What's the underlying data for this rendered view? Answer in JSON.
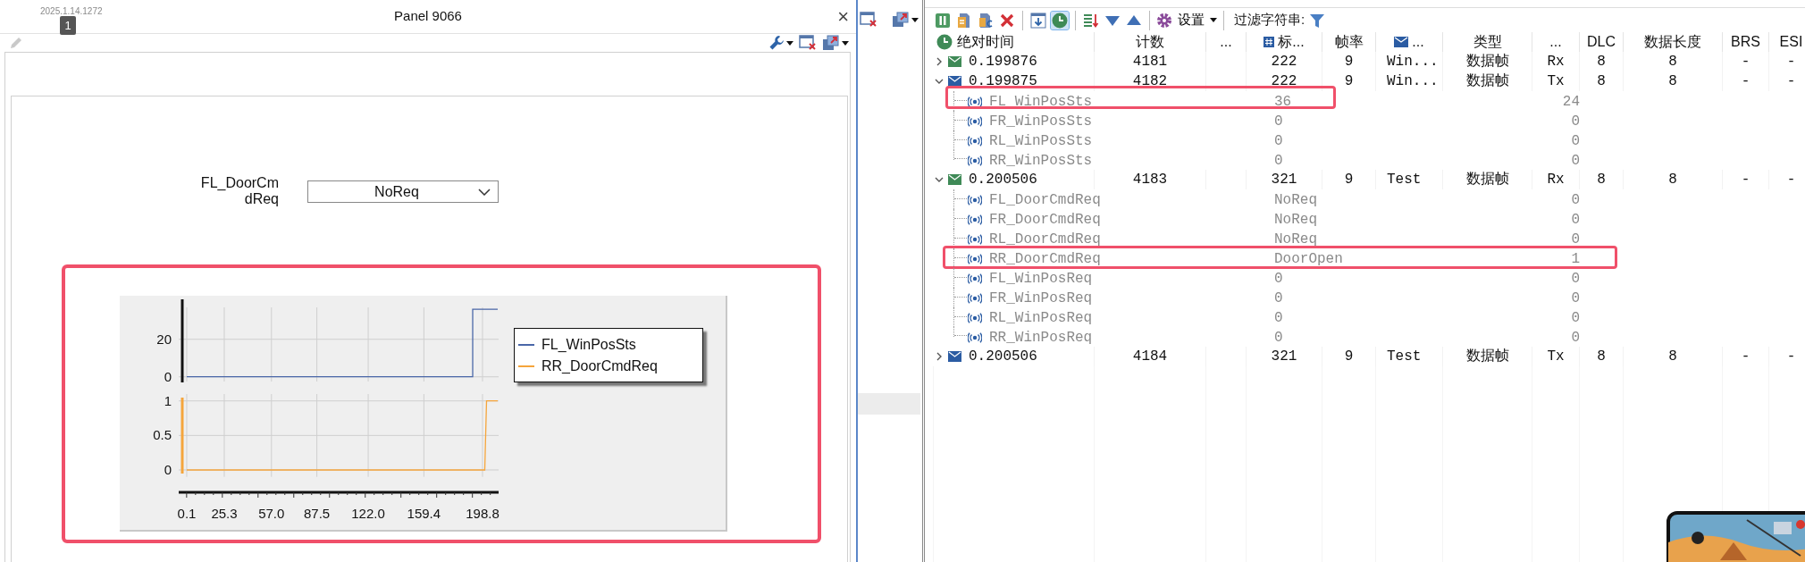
{
  "overlay": {
    "version": "2025.1.14.1272",
    "badge": "1"
  },
  "panel": {
    "title": "Panel 9066",
    "close": "×",
    "toolbar": [
      {
        "kind": "pencil",
        "disabled": true
      },
      {
        "kind": "spacer"
      },
      {
        "kind": "wrench",
        "dropdown": true
      },
      {
        "kind": "close-window"
      },
      {
        "kind": "export",
        "dropdown": true
      }
    ],
    "field": {
      "label": "FL_DoorCmdReq",
      "value": "NoReq"
    },
    "plot": {
      "highlighted": true,
      "upper": {
        "chart_data": {
          "type": "line",
          "grid": true,
          "x": [
            0.1,
            192.2,
            192.2,
            209
          ],
          "xlim": [
            -1.7,
            209
          ],
          "ylim": [
            -2.5,
            37
          ],
          "yticks": [
            0,
            20
          ],
          "series": [
            {
              "name": "FL_WinPosSts",
              "color": "#4a67a8",
              "values": [
                0,
                0,
                36,
                36
              ]
            }
          ]
        }
      },
      "lower": {
        "chart_data": {
          "type": "line",
          "grid": true,
          "x": [
            0.1,
            200.3,
            201.5,
            209
          ],
          "xlim": [
            -1.7,
            209
          ],
          "ylim": [
            -0.1,
            1.1
          ],
          "yticks": [
            0,
            0.5,
            1
          ],
          "xticks": [
            0.1,
            25.3,
            {
              "value": 57,
              "label": "57.0"
            },
            87.5,
            {
              "value": 122,
              "label": "122.0"
            },
            159.4,
            198.8
          ],
          "series": [
            {
              "name": "RR_DoorCmdReq",
              "color": "#f5a53c",
              "values": [
                0,
                0,
                1,
                1
              ]
            }
          ]
        }
      }
    }
  },
  "side_strip": {
    "toolbar": [
      {
        "kind": "close-window"
      },
      {
        "kind": "export",
        "dropdown": true
      }
    ]
  },
  "trace": {
    "toolbar": [
      {
        "kind": "pause",
        "selected": false
      },
      {
        "kind": "page",
        "selected": false
      },
      {
        "kind": "page-c",
        "selected": false
      },
      {
        "kind": "delete",
        "selected": false
      },
      {
        "kind": "separator"
      },
      {
        "kind": "download",
        "selected": false
      },
      {
        "kind": "clock",
        "selected": true
      },
      {
        "kind": "separator"
      },
      {
        "kind": "sort",
        "selected": false
      },
      {
        "kind": "down",
        "selected": false
      },
      {
        "kind": "up",
        "selected": false
      },
      {
        "kind": "separator"
      },
      {
        "kind": "menu",
        "label": "设置",
        "selected": false
      },
      {
        "kind": "separator"
      },
      {
        "kind": "label",
        "label": "过滤字符串:"
      },
      {
        "kind": "filter",
        "selected": false
      }
    ],
    "columns": [
      {
        "label": "绝对时间"
      },
      {
        "label": "计数"
      },
      {
        "label": "..."
      },
      {
        "label": "标..."
      },
      {
        "label": "帧率"
      },
      {
        "label": "..."
      },
      {
        "label": "类型"
      },
      {
        "label": "..."
      },
      {
        "label": "DLC"
      },
      {
        "label": "数据长度"
      },
      {
        "label": "BRS"
      },
      {
        "label": "ESI"
      }
    ],
    "rows": [
      {
        "expanded": false,
        "color": "#3f8a57",
        "cells": {
          "time": "0.199876",
          "count": "4181",
          "id": "222",
          "frame_rate": "9",
          "column_6": "Win...",
          "type": "数据帧",
          "column_8": "Rx",
          "dlc": "8",
          "data_length": "8",
          "brs": "-",
          "esi": "-"
        }
      },
      {
        "expanded": true,
        "color": "#2b5ca3",
        "cells": {
          "time": "0.199875",
          "count": "4182",
          "id": "222",
          "frame_rate": "9",
          "column_6": "Win...",
          "type": "数据帧",
          "column_8": "Tx",
          "dlc": "8",
          "data_length": "8",
          "brs": "-",
          "esi": "-"
        },
        "children": [
          {
            "name": "FL_WinPosSts",
            "value": "36",
            "raw": "24",
            "highlighted": true
          },
          {
            "name": "FR_WinPosSts",
            "value": "0",
            "raw": "0",
            "highlighted": false
          },
          {
            "name": "RL_WinPosSts",
            "value": "0",
            "raw": "0",
            "highlighted": false
          },
          {
            "name": "RR_WinPosSts",
            "value": "0",
            "raw": "0",
            "highlighted": false
          }
        ]
      },
      {
        "expanded": true,
        "color": "#3f8a57",
        "cells": {
          "time": "0.200506",
          "count": "4183",
          "id": "321",
          "frame_rate": "9",
          "column_6": "Test",
          "type": "数据帧",
          "column_8": "Rx",
          "dlc": "8",
          "data_length": "8",
          "brs": "-",
          "esi": "-"
        },
        "children": [
          {
            "name": "FL_DoorCmdReq",
            "value": "NoReq",
            "raw": "0",
            "highlighted": false
          },
          {
            "name": "FR_DoorCmdReq",
            "value": "NoReq",
            "raw": "0",
            "highlighted": false
          },
          {
            "name": "RL_DoorCmdReq",
            "value": "NoReq",
            "raw": "0",
            "highlighted": false
          },
          {
            "name": "RR_DoorCmdReq",
            "value": "DoorOpen",
            "raw": "1",
            "highlighted": true
          },
          {
            "name": "FL_WinPosReq",
            "value": "0",
            "raw": "0",
            "highlighted": false
          },
          {
            "name": "FR_WinPosReq",
            "value": "0",
            "raw": "0",
            "highlighted": false
          },
          {
            "name": "RL_WinPosReq",
            "value": "0",
            "raw": "0",
            "highlighted": false
          },
          {
            "name": "RR_WinPosReq",
            "value": "0",
            "raw": "0",
            "highlighted": false
          }
        ]
      },
      {
        "expanded": false,
        "color": "#2b5ca3",
        "cells": {
          "time": "0.200506",
          "count": "4184",
          "id": "321",
          "frame_rate": "9",
          "column_6": "Test",
          "type": "数据帧",
          "column_8": "Tx",
          "dlc": "8",
          "data_length": "8",
          "brs": "-",
          "esi": "-"
        }
      }
    ]
  }
}
